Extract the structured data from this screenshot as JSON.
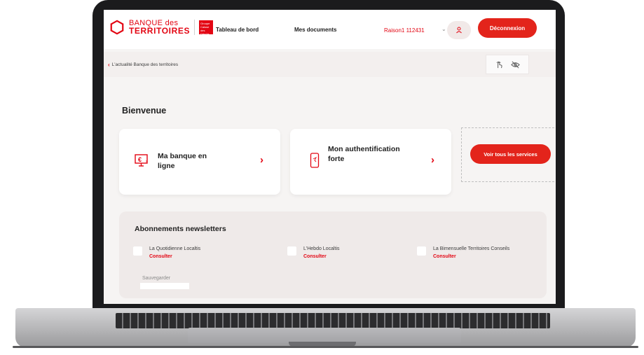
{
  "header": {
    "logo_line1": "BANQUE des",
    "logo_line2": "TERRITOIRES",
    "logo_badge": "Groupe Caisse des Dépôts",
    "nav": [
      "Tableau de bord",
      "Mes documents"
    ],
    "reason": "Raison1 112431",
    "logout_label": "Déconnexion"
  },
  "subheader": {
    "back_link": "L'actualité Banque des territoires"
  },
  "main": {
    "welcome": "Bienvenue",
    "cards": [
      {
        "label": "Ma banque en ligne",
        "icon": "euro-screen-icon"
      },
      {
        "label": "Mon authentification forte",
        "icon": "phone-icon"
      }
    ],
    "services_button": "Voir tous les services"
  },
  "newsletters": {
    "title": "Abonnements newsletters",
    "items": [
      {
        "name": "La Quotidienne Localtis",
        "link": "Consulter"
      },
      {
        "name": "L'Hebdo Localtis",
        "link": "Consulter"
      },
      {
        "name": "La Bimensuelle Territoires Conseils",
        "link": "Consulter"
      }
    ],
    "save_label": "Sauvegarder"
  },
  "colors": {
    "brand_red": "#e3241b",
    "panel_bg": "#efeae9"
  }
}
